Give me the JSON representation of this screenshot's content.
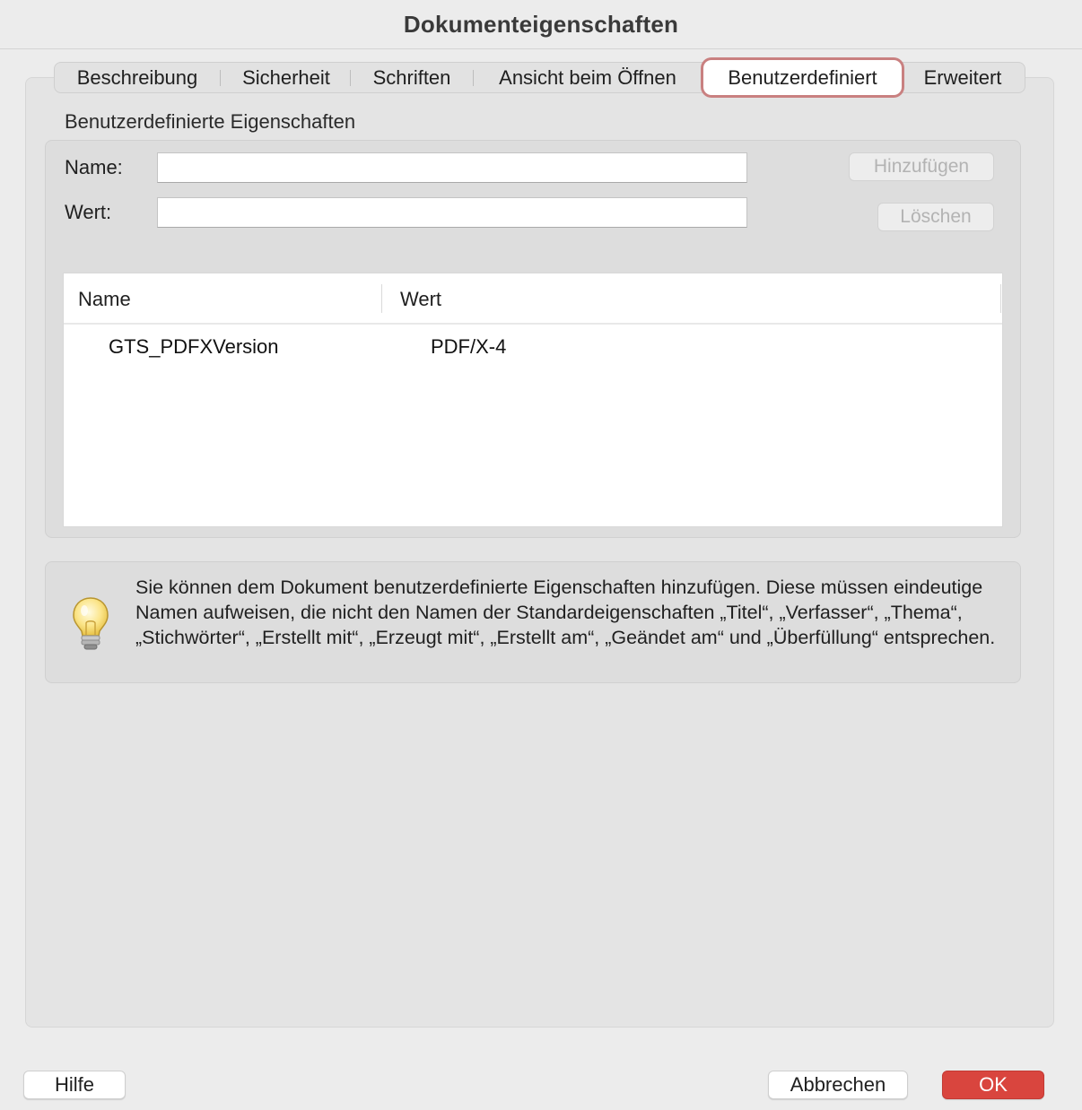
{
  "window": {
    "title": "Dokumenteigenschaften"
  },
  "tabs": [
    {
      "label": "Beschreibung"
    },
    {
      "label": "Sicherheit"
    },
    {
      "label": "Schriften"
    },
    {
      "label": "Ansicht beim Öffnen"
    },
    {
      "label": "Benutzerdefiniert",
      "active": true
    },
    {
      "label": "Erweitert"
    }
  ],
  "custom": {
    "section_title": "Benutzerdefinierte Eigenschaften",
    "name_label": "Name:",
    "value_label": "Wert:",
    "name_value": "",
    "value_value": "",
    "add_button": "Hinzufügen",
    "delete_button": "Löschen",
    "table": {
      "columns": [
        "Name",
        "Wert"
      ],
      "rows": [
        {
          "name": "GTS_PDFXVersion",
          "value": "PDF/X-4"
        }
      ]
    }
  },
  "hint": {
    "icon": "lightbulb-icon",
    "text": "Sie können dem Dokument benutzerdefinierte Eigenschaften hinzufügen. Diese müssen eindeutige Namen aufweisen, die nicht den Namen der Standardeigenschaften „Titel“, „Verfasser“, „Thema“, „Stichwörter“, „Erstellt mit“, „Erzeugt mit“, „Erstellt am“, „Geändet am“ und „Überfüllung“ entsprechen."
  },
  "footer": {
    "help": "Hilfe",
    "cancel": "Abbrechen",
    "ok": "OK"
  },
  "colors": {
    "primary": "#d9453e",
    "active_tab_outline": "#c98080"
  }
}
